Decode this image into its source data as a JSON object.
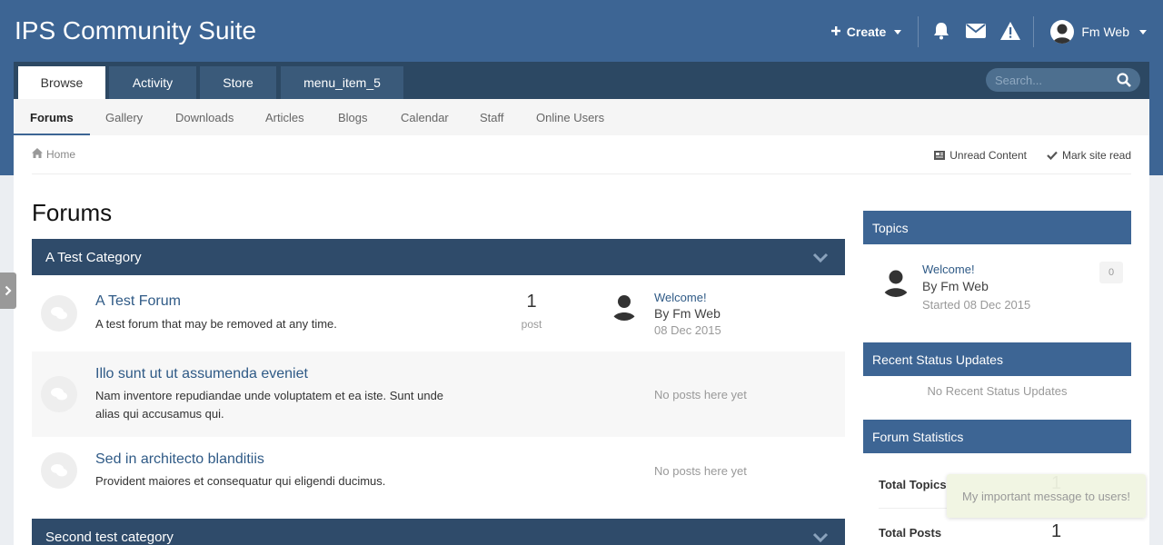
{
  "header": {
    "site_title": "IPS Community Suite",
    "create_label": "Create",
    "user_name": "Fm Web"
  },
  "nav": {
    "tabs": [
      {
        "label": "Browse",
        "active": true
      },
      {
        "label": "Activity"
      },
      {
        "label": "Store"
      },
      {
        "label": "menu_item_5"
      }
    ],
    "search_placeholder": "Search...",
    "sub_items": [
      {
        "label": "Forums",
        "active": true
      },
      {
        "label": "Gallery"
      },
      {
        "label": "Downloads"
      },
      {
        "label": "Articles"
      },
      {
        "label": "Blogs"
      },
      {
        "label": "Calendar"
      },
      {
        "label": "Staff"
      },
      {
        "label": "Online Users"
      }
    ]
  },
  "breadcrumb": {
    "home": "Home",
    "unread": "Unread Content",
    "mark_read": "Mark site read"
  },
  "main": {
    "title": "Forums",
    "categories": [
      {
        "name": "A Test Category",
        "forums": [
          {
            "title": "A Test Forum",
            "description": "A test forum that may be removed at any time.",
            "posts": "1",
            "posts_label": "post",
            "last_title": "Welcome!",
            "last_by": "By Fm Web",
            "last_date": "08 Dec 2015"
          },
          {
            "title": "Illo sunt ut ut assumenda eveniet",
            "description": "Nam inventore repudiandae unde voluptatem et ea iste. Sunt unde alias qui accusamus qui.",
            "no_posts": "No posts here yet"
          },
          {
            "title": "Sed in architecto blanditiis",
            "description": "Provident maiores et consequatur qui eligendi ducimus.",
            "no_posts": "No posts here yet"
          }
        ]
      },
      {
        "name": "Second test category"
      }
    ]
  },
  "sidebar": {
    "topics": {
      "header": "Topics",
      "title": "Welcome!",
      "by": "By Fm Web",
      "date": "Started 08 Dec 2015",
      "count": "0"
    },
    "status": {
      "header": "Recent Status Updates",
      "empty": "No Recent Status Updates"
    },
    "stats": {
      "header": "Forum Statistics",
      "total_topics_label": "Total Topics",
      "total_topics": "1",
      "total_posts_label": "Total Posts",
      "total_posts": "1"
    }
  },
  "toast": {
    "message": "My important message to users!"
  },
  "colors": {
    "header": "#3d6594",
    "nav_dark": "#2c4863",
    "category": "#2f4b6a",
    "link": "#2f5a86"
  }
}
